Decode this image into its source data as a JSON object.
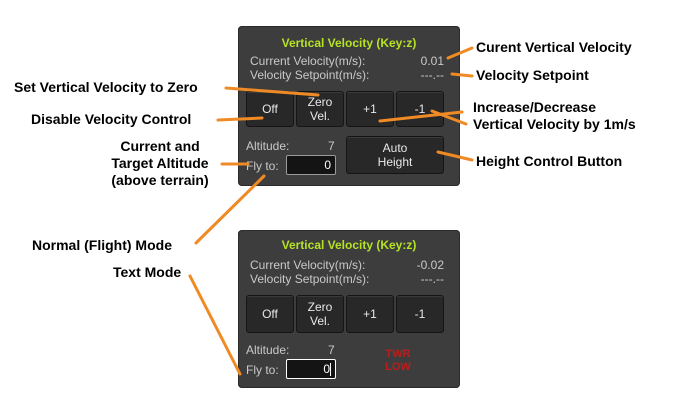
{
  "top_panel": {
    "title": "Vertical Velocity (Key:z)",
    "current_velocity_label": "Current Velocity(m/s):",
    "current_velocity_value": "0.01",
    "setpoint_label": "Velocity Setpoint(m/s):",
    "setpoint_value": "---.--",
    "buttons": {
      "off": "Off",
      "zero_line1": "Zero",
      "zero_line2": "Vel.",
      "plus1": "+1",
      "minus1": "-1"
    },
    "altitude_label": "Altitude:",
    "altitude_value": "7",
    "fly_to_label": "Fly to:",
    "fly_to_value": "0",
    "auto_height_line1": "Auto",
    "auto_height_line2": "Height"
  },
  "bottom_panel": {
    "title": "Vertical Velocity (Key:z)",
    "current_velocity_label": "Current Velocity(m/s):",
    "current_velocity_value": "-0.02",
    "setpoint_label": "Velocity Setpoint(m/s):",
    "setpoint_value": "---.--",
    "buttons": {
      "off": "Off",
      "zero_line1": "Zero",
      "zero_line2": "Vel.",
      "plus1": "+1",
      "minus1": "-1"
    },
    "altitude_label": "Altitude:",
    "altitude_value": "7",
    "fly_to_label": "Fly to:",
    "fly_to_value": "0",
    "twr_line1": "TWR",
    "twr_line2": "LOW"
  },
  "callouts": {
    "current_vertical_velocity": "Curent Vertical Velocity",
    "velocity_setpoint": "Velocity  Setpoint",
    "set_zero": "Set Vertical Velocity to Zero",
    "disable_control": "Disable Velocity Control",
    "increase_decrease_line1": "Increase/Decrease",
    "increase_decrease_line2": "Vertical Velocity by 1m/s",
    "altitude_line1": "Current and",
    "altitude_line2": "Target Altitude",
    "altitude_line3": "(above terrain)",
    "height_control": "Height Control Button",
    "normal_mode": "Normal (Flight) Mode",
    "text_mode": "Text Mode"
  },
  "colors": {
    "panel_bg": "#3d3d3d",
    "title": "#b6e324",
    "callout_line": "#f08a24",
    "warning": "#b91e1e"
  }
}
